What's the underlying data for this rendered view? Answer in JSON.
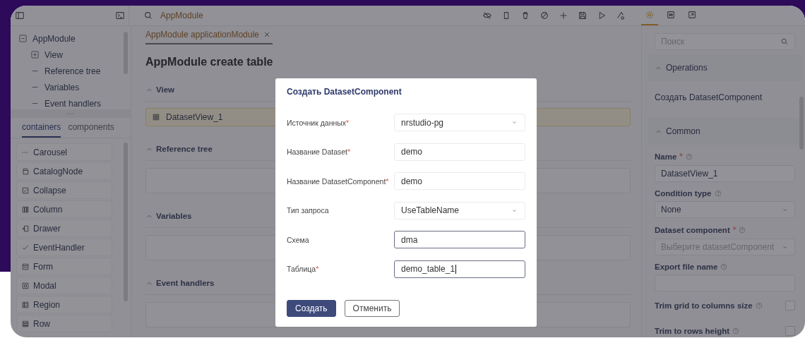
{
  "topbar": {
    "search_value": "AppModule"
  },
  "tree": [
    {
      "label": "AppModule",
      "expanded": true,
      "children": [
        {
          "label": "View",
          "expanded": false
        },
        {
          "label": "Reference tree"
        },
        {
          "label": "Variables"
        },
        {
          "label": "Event handlers"
        }
      ]
    }
  ],
  "palette_tabs": [
    {
      "label": "containers",
      "selected": true
    },
    {
      "label": "components",
      "selected": false
    }
  ],
  "palette_items": [
    {
      "label": "Carousel"
    },
    {
      "label": "CatalogNode"
    },
    {
      "label": "Collapse"
    },
    {
      "label": "Column"
    },
    {
      "label": "Drawer"
    },
    {
      "label": "EventHandler"
    },
    {
      "label": "Form"
    },
    {
      "label": "Modal"
    },
    {
      "label": "Region"
    },
    {
      "label": "Row"
    }
  ],
  "editor_tabs": [
    {
      "label": "AppModule applicationModule",
      "selected": true
    }
  ],
  "page_title": "AppModule create table",
  "sections": [
    {
      "title": "View",
      "expanded": true,
      "items": [
        {
          "label": "DatasetView_1",
          "selected": true
        }
      ]
    },
    {
      "title": "Reference tree",
      "expanded": true
    },
    {
      "title": "Variables",
      "expanded": true
    },
    {
      "title": "Event handlers",
      "expanded": true
    }
  ],
  "dialog": {
    "title": "Создать DatasetComponent",
    "fields": [
      {
        "kind": "select",
        "label": "Источник данных",
        "required_mark": "*",
        "value": "nrstudio-pg",
        "active": false
      },
      {
        "kind": "input",
        "label": "Название Dataset",
        "required_mark": "*",
        "value": "demo",
        "active": false
      },
      {
        "kind": "input",
        "label": "Название DatasetComponent",
        "required_mark": "*",
        "value": "demo",
        "active": false
      },
      {
        "kind": "select",
        "label": "Тип запроса",
        "value": "UseTableName",
        "active": false
      },
      {
        "kind": "input",
        "label": "Схема",
        "value": "dma",
        "active": true
      },
      {
        "kind": "input",
        "label": "Таблица",
        "required_mark": "*",
        "value": "demo_table_1",
        "active": true,
        "focused": true
      }
    ],
    "buttons": [
      {
        "label": "Создать",
        "kind": "primary"
      },
      {
        "label": "Отменить",
        "kind": "secondary"
      }
    ]
  },
  "properties": {
    "tabs": [
      {
        "selected": true
      },
      {
        "selected": false
      },
      {
        "selected": false
      }
    ],
    "search": {
      "placeholder": "Поиск"
    },
    "sections": [
      {
        "title": "Operations",
        "expanded": true,
        "actions": [
          {
            "label": "Создать DatasetComponent"
          }
        ]
      },
      {
        "title": "Common",
        "expanded": true,
        "fields": [
          {
            "kind": "input",
            "label": "Name",
            "required_mark": "*",
            "help": true,
            "value": "DatasetView_1"
          },
          {
            "kind": "select",
            "label": "Condition type",
            "help": true,
            "value": "None"
          },
          {
            "kind": "select",
            "label": "Dataset component",
            "required_mark": "*",
            "help": true,
            "placeholder": "Выберите datasetComponent"
          },
          {
            "kind": "input",
            "label": "Export file name",
            "help": true
          },
          {
            "kind": "checkbox",
            "label": "Trim grid to columns size",
            "help": true,
            "checked": false
          },
          {
            "kind": "checkbox",
            "label": "Trim to rows height",
            "help": true,
            "checked": false
          }
        ]
      }
    ]
  }
}
